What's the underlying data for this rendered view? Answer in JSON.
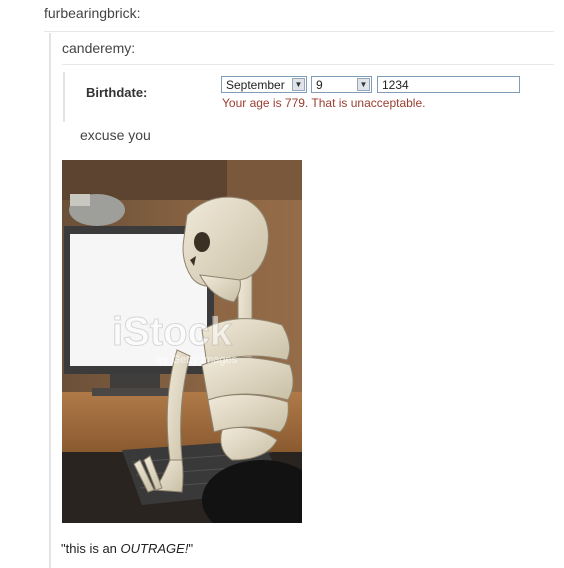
{
  "post": {
    "user1": "furbearingbrick:",
    "user2": "canderemy:",
    "birthdate_label": "Birthdate:",
    "month": "September",
    "day": "9",
    "year": "1234",
    "age_message": "Your age is 779. That is unacceptable.",
    "reply": "excuse you",
    "quote_open": "\"this is an ",
    "quote_emph": "OUTRAGE!",
    "quote_close": "\""
  },
  "image": {
    "watermark": "iStock",
    "watermark_sub": "by Getty Images"
  }
}
